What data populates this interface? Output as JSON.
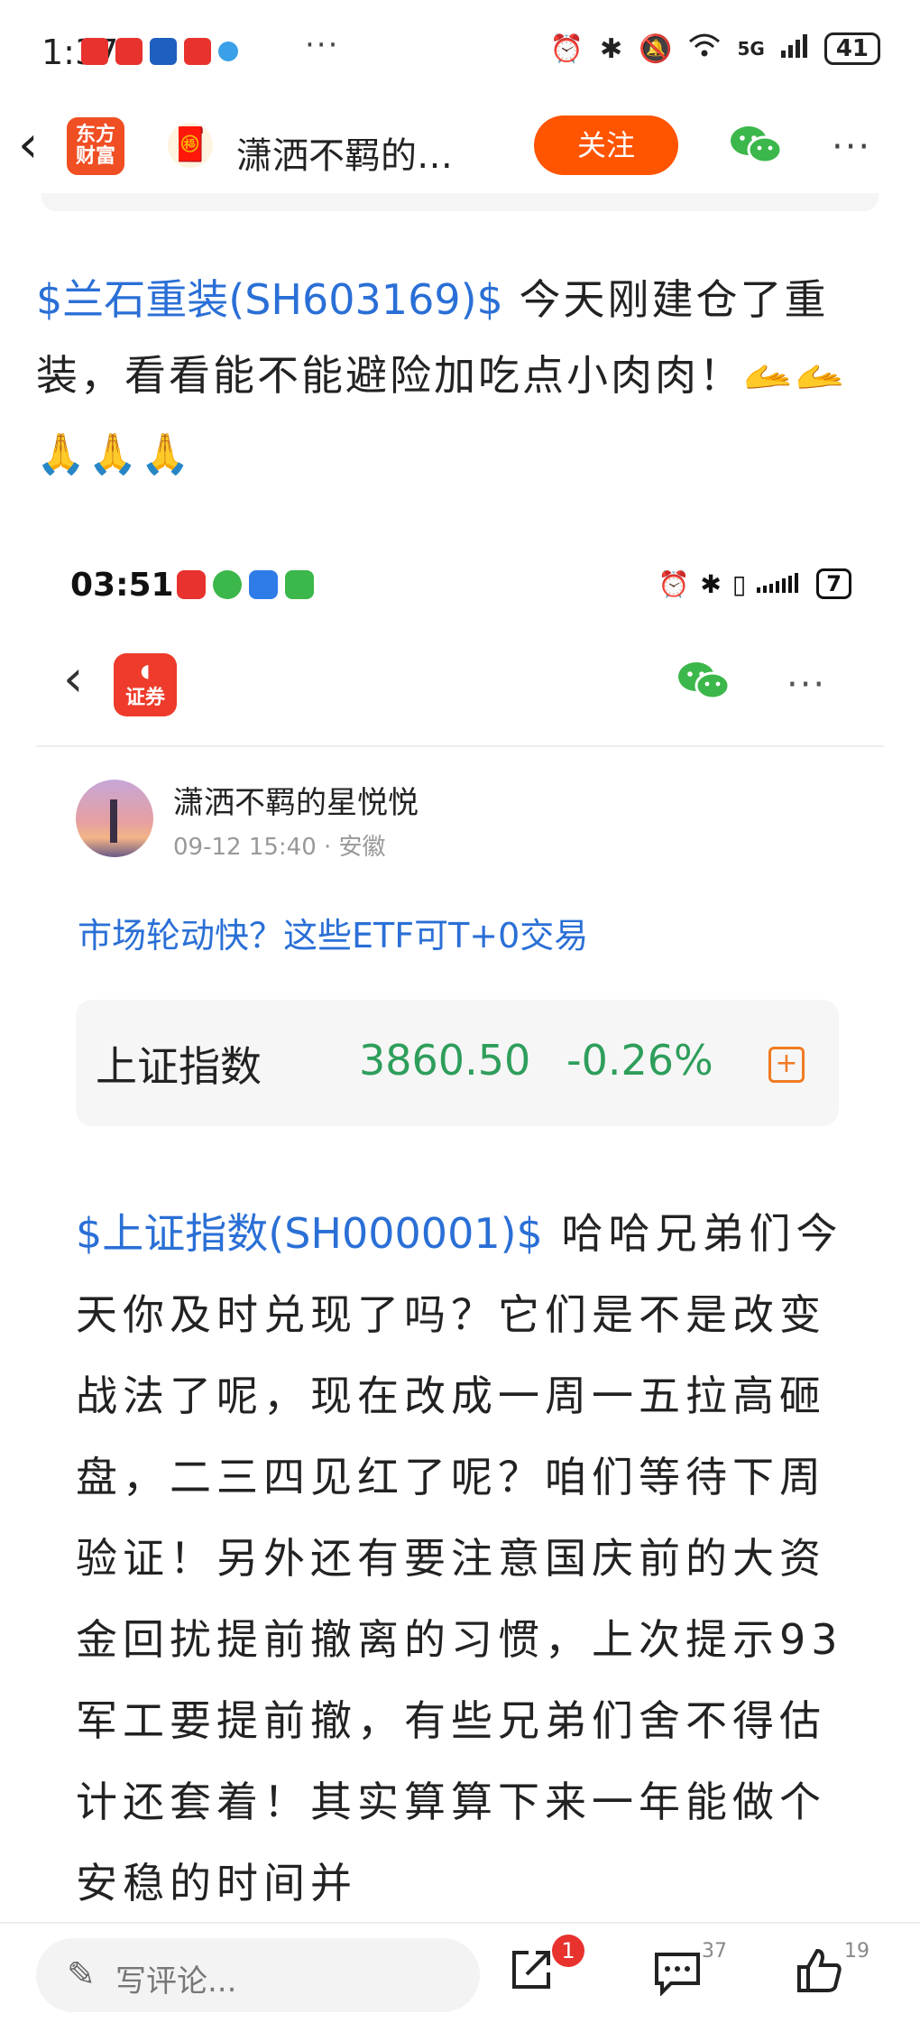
{
  "status_bar": {
    "time": "1:37",
    "overflow": "···",
    "network": "5G",
    "battery": "41"
  },
  "header": {
    "app_logo_line1": "东方",
    "app_logo_line2": "财富",
    "author_title": "潇洒不羁的…",
    "follow_label": "关注",
    "more": "···"
  },
  "post": {
    "stock_tag": "$兰石重装(SH603169)$",
    "text": " 今天刚建仓了重装，看看能不能避险加吃点小肉肉！",
    "emojis_line1": "🫴🫴",
    "emojis_line2": "🙏🙏🙏"
  },
  "embedded_screenshot": {
    "status_time": "03:51",
    "battery": "7",
    "app_logo": "证券",
    "more": "···",
    "author_name": "潇洒不羁的星悦悦",
    "meta": "09-12 15:40 · 安徽",
    "etf_link": "市场轮动快？这些ETF可T+0交易",
    "index_card": {
      "name": "上证指数",
      "value": "3860.50",
      "change": "-0.26%",
      "add_symbol": "+"
    },
    "body_stock_tag": "$上证指数(SH000001)$",
    "body_text": " 哈哈兄弟们今天你及时兑现了吗？它们是不是改变战法了呢，现在改成一周一五拉高砸盘，二三四见红了呢？咱们等待下周验证！另外还有要注意国庆前的大资金回扰提前撤离的习惯，上次提示93军工要提前撤，有些兄弟们舍不得估计还套着！其实算算下来一年能做个安稳的时间并"
  },
  "bottom_bar": {
    "comment_placeholder": "写评论...",
    "share_badge": "1",
    "comment_count": "37",
    "like_count": "19"
  },
  "colors": {
    "accent_orange": "#ff5400",
    "link_blue": "#2a6fd6",
    "index_green": "#2e9e5b",
    "badge_red": "#e8322e"
  }
}
